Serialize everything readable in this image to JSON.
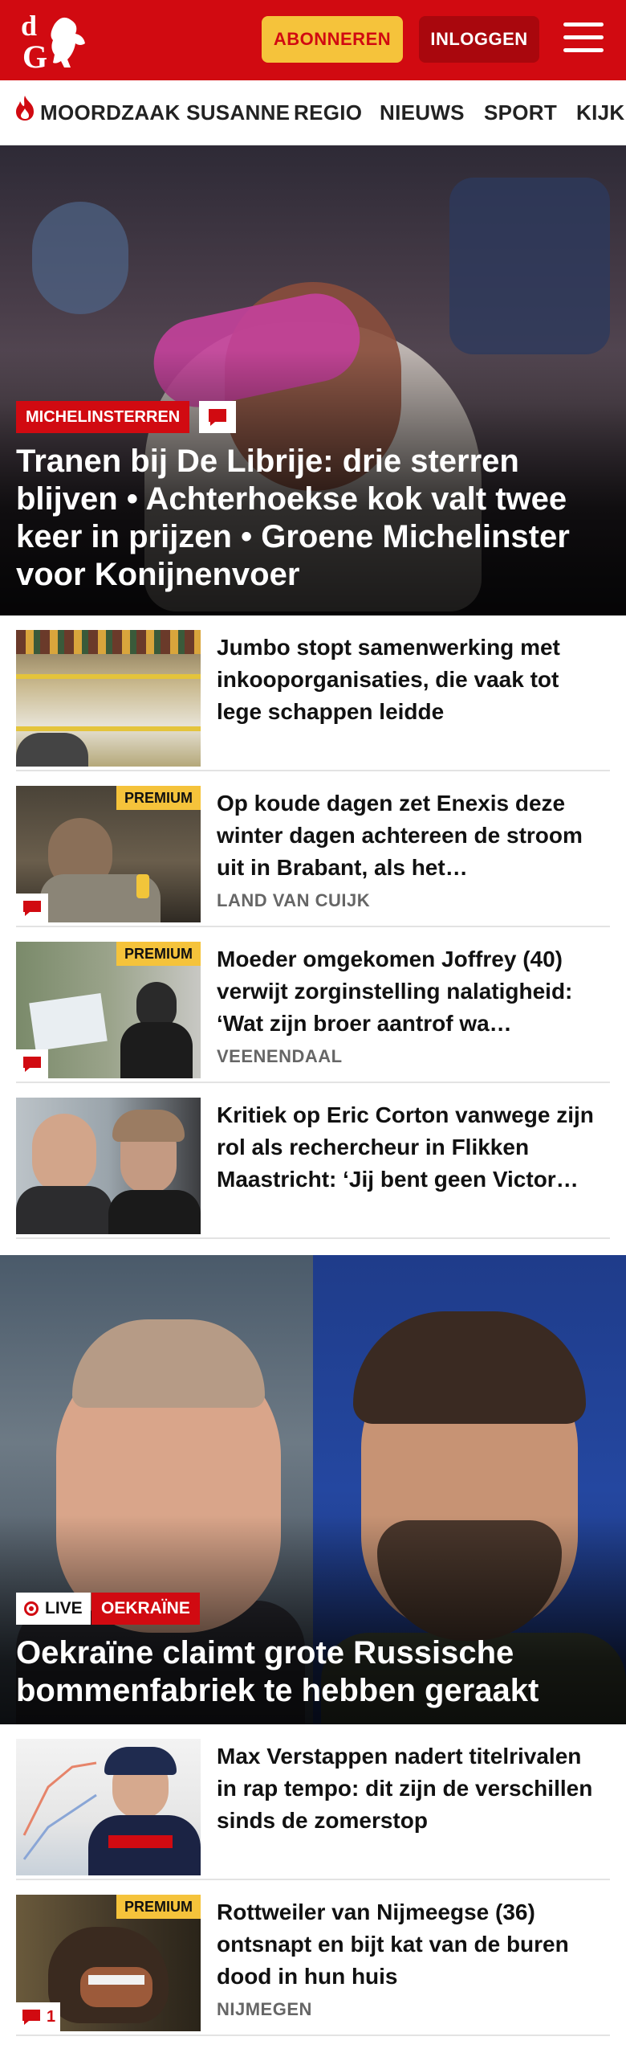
{
  "header": {
    "logo_text": "dG",
    "subscribe_label": "ABONNEREN",
    "login_label": "INLOGGEN",
    "brand_color": "#d10a11",
    "accent_color": "#f5c33b"
  },
  "nav": {
    "items": [
      {
        "label": "MOORDZAAK SUSANNE",
        "icon": "flame-icon"
      },
      {
        "label": "REGIO"
      },
      {
        "label": "NIEUWS"
      },
      {
        "label": "SPORT"
      },
      {
        "label": "KIJK"
      }
    ]
  },
  "hero": {
    "label": "MICHELINSTERREN",
    "title": "Tranen bij De Librije: drie sterren blijven • Achterhoekse kok valt twee keer in prijzen • Groene Michelinster voor Konijnenvoer"
  },
  "articles": [
    {
      "title": "Jumbo stopt samenwerking met inkooporganisaties, die vaak tot lege schappen leidde",
      "premium": "",
      "location": "",
      "comments": ""
    },
    {
      "title": "Op koude dagen zet Enexis deze winter dagen achtereen de stroom uit in Brabant, als het…",
      "premium": "PREMIUM",
      "location": "LAND VAN CUIJK",
      "comments": ""
    },
    {
      "title": "Moeder omgekomen Joffrey (40) verwijt zorginstelling nalatig­heid: ‘Wat zijn broer aantrof wa…",
      "premium": "PREMIUM",
      "location": "VEENENDAAL",
      "comments": ""
    },
    {
      "title": "Kritiek op Eric Corton vanwege zijn rol als rechercheur in Flikken Maastricht: ‘Jij bent geen Victor…",
      "premium": "",
      "location": "",
      "comments": ""
    }
  ],
  "hero2": {
    "live_label": "LIVE",
    "section_label": "OEKRAÏNE",
    "title": "Oekraïne claimt grote Russische bommenfabriek te hebben geraakt"
  },
  "articles2": [
    {
      "title": "Max Verstappen nadert titelriva­len in rap tempo: dit zijn de verschillen sinds de zomerstop",
      "premium": "",
      "location": "",
      "comments": ""
    },
    {
      "title": "Rottweiler van Nijmeegse (36) ontsnapt en bijt kat van de buren dood in hun huis",
      "premium": "PREMIUM",
      "location": "NIJMEGEN",
      "comments": "1"
    }
  ]
}
